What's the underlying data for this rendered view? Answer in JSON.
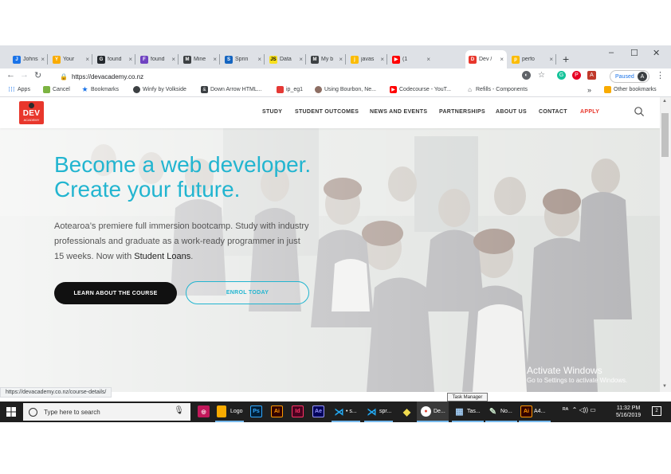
{
  "browser": {
    "tabs": [
      {
        "label": "Johns",
        "fav_color": "#1a73e8",
        "fav_glyph": "J"
      },
      {
        "label": "Your",
        "fav_color": "#f9ab00",
        "fav_glyph": "Y"
      },
      {
        "label": "found",
        "fav_color": "#24292e",
        "fav_glyph": "G"
      },
      {
        "label": "found",
        "fav_color": "#6f42c1",
        "fav_glyph": "F"
      },
      {
        "label": "Mine",
        "fav_color": "#3c4043",
        "fav_glyph": "M"
      },
      {
        "label": "Sprin",
        "fav_color": "#1565c0",
        "fav_glyph": "S"
      },
      {
        "label": "Data",
        "fav_color": "#f7df1e",
        "fav_glyph": "JS"
      },
      {
        "label": "My b",
        "fav_color": "#3c4043",
        "fav_glyph": "M"
      },
      {
        "label": "javas",
        "fav_color": "#fbbc04",
        "fav_glyph": "j"
      },
      {
        "label": "(1",
        "fav_color": "#ff0000",
        "fav_glyph": "▶"
      },
      {
        "label": "Dev /",
        "fav_color": "#e8372c",
        "fav_glyph": "D",
        "active": true
      },
      {
        "label": "perfo",
        "fav_color": "#fbbc04",
        "fav_glyph": "p"
      }
    ],
    "url": "https://devacademy.co.nz",
    "profile_status": "Paused",
    "profile_initial": "A"
  },
  "bookmarks": {
    "apps": "Apps",
    "items": [
      "Cancel",
      "Bookmarks",
      "Winfy by Volkside",
      "Down Arrow HTML...",
      "ip_eg1",
      "Using Bourbon, Ne...",
      "Codecourse - YouT...",
      "Refills - Components"
    ],
    "more": "»",
    "other": "Other bookmarks"
  },
  "site": {
    "logo_text": "DEV",
    "logo_sub": "ACADEMY",
    "nav": [
      "STUDY",
      "STUDENT OUTCOMES",
      "NEWS AND EVENTS",
      "PARTNERSHIPS",
      "ABOUT US",
      "CONTACT",
      "APPLY"
    ],
    "hero": {
      "headline_1": "Become a web developer.",
      "headline_2": "Create your future.",
      "sub_1": "Aotearoa’s premiere full immersion bootcamp. Study with industry professionals and graduate as a work-ready programmer in just 15 weeks. Now with ",
      "sub_link": "Student Loans",
      "sub_end": ".",
      "btn_primary": "LEARN ABOUT THE COURSE",
      "btn_secondary": "ENROL TODAY"
    },
    "accent": "#22b5d0",
    "apply_color": "#e8372c"
  },
  "overlay": {
    "activate_title": "Activate Windows",
    "activate_sub": "Go to Settings to activate Windows."
  },
  "status_url": "https://devacademy.co.nz/course-details/",
  "tooltip": "Task Manager",
  "taskbar": {
    "search_placeholder": "Type here to search",
    "apps": [
      {
        "label": "Logo"
      },
      {
        "label": "• s..."
      },
      {
        "label": "spr..."
      },
      {
        "label": "De..."
      },
      {
        "label": "Tas..."
      },
      {
        "label": "No..."
      },
      {
        "label": "A4..."
      }
    ],
    "time": "11:32 PM",
    "date": "5/16/2019",
    "notification_count": "2"
  }
}
